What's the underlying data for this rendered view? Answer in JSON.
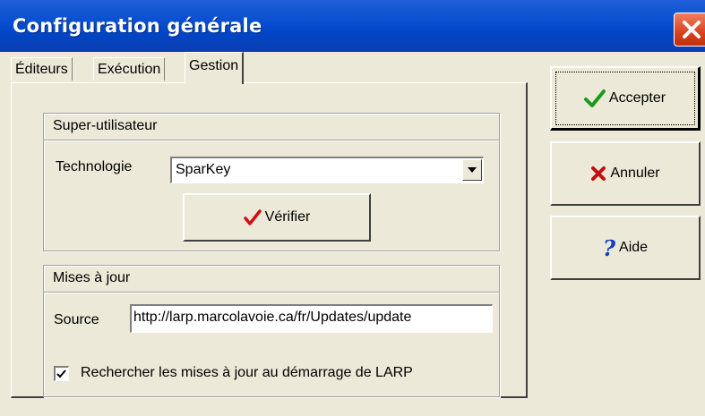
{
  "window": {
    "title": "Configuration générale"
  },
  "tabs": [
    {
      "label": "Éditeurs",
      "active": false
    },
    {
      "label": "Exécution",
      "active": false
    },
    {
      "label": "Gestion",
      "active": true
    }
  ],
  "super_user": {
    "heading": "Super-utilisateur",
    "technology_label": "Technologie",
    "technology_value": "SparKey",
    "verify_label": "Vérifier"
  },
  "updates": {
    "heading": "Mises à jour",
    "source_label": "Source",
    "source_value": "http://larp.marcolavoie.ca/fr/Updates/update",
    "check_on_start_label": "Rechercher les mises à jour au démarrage de LARP",
    "check_on_start_checked": true
  },
  "actions": {
    "accept_label": "Accepter",
    "cancel_label": "Annuler",
    "help_label": "Aide"
  },
  "colors": {
    "titlebar": "#0a4fd0",
    "face": "#ece9d8",
    "check_green": "#1a9a1a",
    "check_red": "#d01010",
    "cancel_x": "#c01010",
    "help_blue": "#1040c0"
  },
  "icons": {
    "close": "close-icon",
    "accept": "green-check-icon",
    "verify": "red-check-icon",
    "cancel": "red-x-icon",
    "help": "question-mark-icon"
  }
}
